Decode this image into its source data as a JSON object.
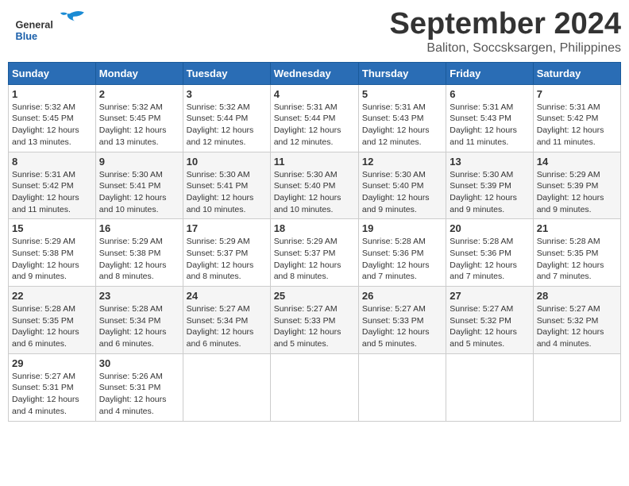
{
  "header": {
    "title": "September 2024",
    "subtitle": "Baliton, Soccsksargen, Philippines"
  },
  "logo": {
    "general": "General",
    "blue": "Blue"
  },
  "columns": [
    "Sunday",
    "Monday",
    "Tuesday",
    "Wednesday",
    "Thursday",
    "Friday",
    "Saturday"
  ],
  "weeks": [
    [
      {
        "day": "1",
        "sunrise": "5:32 AM",
        "sunset": "5:45 PM",
        "daylight": "12 hours and 13 minutes."
      },
      {
        "day": "2",
        "sunrise": "5:32 AM",
        "sunset": "5:45 PM",
        "daylight": "12 hours and 13 minutes."
      },
      {
        "day": "3",
        "sunrise": "5:32 AM",
        "sunset": "5:44 PM",
        "daylight": "12 hours and 12 minutes."
      },
      {
        "day": "4",
        "sunrise": "5:31 AM",
        "sunset": "5:44 PM",
        "daylight": "12 hours and 12 minutes."
      },
      {
        "day": "5",
        "sunrise": "5:31 AM",
        "sunset": "5:43 PM",
        "daylight": "12 hours and 12 minutes."
      },
      {
        "day": "6",
        "sunrise": "5:31 AM",
        "sunset": "5:43 PM",
        "daylight": "12 hours and 11 minutes."
      },
      {
        "day": "7",
        "sunrise": "5:31 AM",
        "sunset": "5:42 PM",
        "daylight": "12 hours and 11 minutes."
      }
    ],
    [
      {
        "day": "8",
        "sunrise": "5:31 AM",
        "sunset": "5:42 PM",
        "daylight": "12 hours and 11 minutes."
      },
      {
        "day": "9",
        "sunrise": "5:30 AM",
        "sunset": "5:41 PM",
        "daylight": "12 hours and 10 minutes."
      },
      {
        "day": "10",
        "sunrise": "5:30 AM",
        "sunset": "5:41 PM",
        "daylight": "12 hours and 10 minutes."
      },
      {
        "day": "11",
        "sunrise": "5:30 AM",
        "sunset": "5:40 PM",
        "daylight": "12 hours and 10 minutes."
      },
      {
        "day": "12",
        "sunrise": "5:30 AM",
        "sunset": "5:40 PM",
        "daylight": "12 hours and 9 minutes."
      },
      {
        "day": "13",
        "sunrise": "5:30 AM",
        "sunset": "5:39 PM",
        "daylight": "12 hours and 9 minutes."
      },
      {
        "day": "14",
        "sunrise": "5:29 AM",
        "sunset": "5:39 PM",
        "daylight": "12 hours and 9 minutes."
      }
    ],
    [
      {
        "day": "15",
        "sunrise": "5:29 AM",
        "sunset": "5:38 PM",
        "daylight": "12 hours and 9 minutes."
      },
      {
        "day": "16",
        "sunrise": "5:29 AM",
        "sunset": "5:38 PM",
        "daylight": "12 hours and 8 minutes."
      },
      {
        "day": "17",
        "sunrise": "5:29 AM",
        "sunset": "5:37 PM",
        "daylight": "12 hours and 8 minutes."
      },
      {
        "day": "18",
        "sunrise": "5:29 AM",
        "sunset": "5:37 PM",
        "daylight": "12 hours and 8 minutes."
      },
      {
        "day": "19",
        "sunrise": "5:28 AM",
        "sunset": "5:36 PM",
        "daylight": "12 hours and 7 minutes."
      },
      {
        "day": "20",
        "sunrise": "5:28 AM",
        "sunset": "5:36 PM",
        "daylight": "12 hours and 7 minutes."
      },
      {
        "day": "21",
        "sunrise": "5:28 AM",
        "sunset": "5:35 PM",
        "daylight": "12 hours and 7 minutes."
      }
    ],
    [
      {
        "day": "22",
        "sunrise": "5:28 AM",
        "sunset": "5:35 PM",
        "daylight": "12 hours and 6 minutes."
      },
      {
        "day": "23",
        "sunrise": "5:28 AM",
        "sunset": "5:34 PM",
        "daylight": "12 hours and 6 minutes."
      },
      {
        "day": "24",
        "sunrise": "5:27 AM",
        "sunset": "5:34 PM",
        "daylight": "12 hours and 6 minutes."
      },
      {
        "day": "25",
        "sunrise": "5:27 AM",
        "sunset": "5:33 PM",
        "daylight": "12 hours and 5 minutes."
      },
      {
        "day": "26",
        "sunrise": "5:27 AM",
        "sunset": "5:33 PM",
        "daylight": "12 hours and 5 minutes."
      },
      {
        "day": "27",
        "sunrise": "5:27 AM",
        "sunset": "5:32 PM",
        "daylight": "12 hours and 5 minutes."
      },
      {
        "day": "28",
        "sunrise": "5:27 AM",
        "sunset": "5:32 PM",
        "daylight": "12 hours and 4 minutes."
      }
    ],
    [
      {
        "day": "29",
        "sunrise": "5:27 AM",
        "sunset": "5:31 PM",
        "daylight": "12 hours and 4 minutes."
      },
      {
        "day": "30",
        "sunrise": "5:26 AM",
        "sunset": "5:31 PM",
        "daylight": "12 hours and 4 minutes."
      },
      null,
      null,
      null,
      null,
      null
    ]
  ]
}
